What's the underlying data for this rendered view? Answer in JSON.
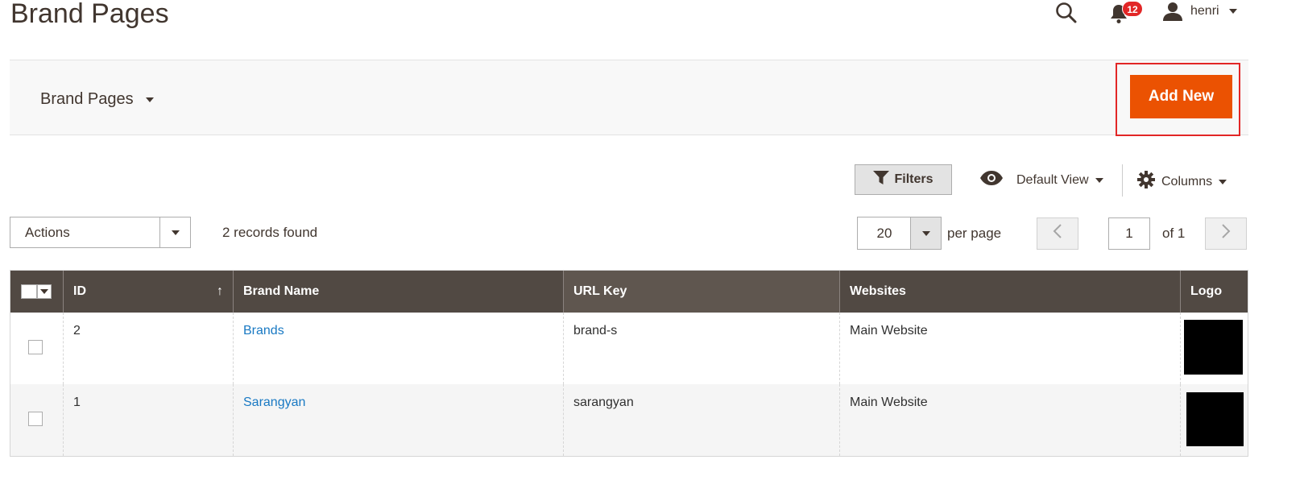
{
  "header": {
    "title": "Brand Pages",
    "notifications_count": "12",
    "user_name": "henri",
    "icons": [
      "search-icon",
      "bell-icon",
      "user-icon"
    ]
  },
  "actions_band": {
    "store_switcher_label": "Brand Pages",
    "add_new_label": "Add New"
  },
  "toolbar": {
    "filters_label": "Filters",
    "view_label": "Default View",
    "columns_label": "Columns",
    "mass_action_label": "Actions",
    "records_found": "2 records found",
    "per_page_value": "20",
    "per_page_label": "per page",
    "current_page": "1",
    "total_pages_label": "of 1"
  },
  "grid": {
    "columns": [
      "ID",
      "Brand Name",
      "URL Key",
      "Websites",
      "Logo"
    ],
    "sort_indicator": "↑",
    "rows": [
      {
        "id": "2",
        "brand_name": "Brands",
        "url_key": "brand-s",
        "websites": "Main Website"
      },
      {
        "id": "1",
        "brand_name": "Sarangyan",
        "url_key": "sarangyan",
        "websites": "Main Website"
      }
    ]
  },
  "colors": {
    "accent": "#eb5202",
    "header_bg": "#514943",
    "link": "#1979c3",
    "badge": "#e22626",
    "highlight_border": "#e22626"
  }
}
